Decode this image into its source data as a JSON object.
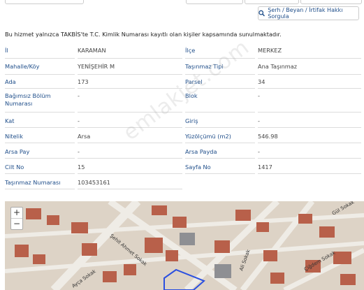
{
  "toolbar": {
    "query_label": "Şerh / Beyan / İrtifak Hakkı Sorgula"
  },
  "notice": "Bu hizmet yalnızca TAKBİS'te T.C. Kimlik Numarası kayıtlı olan kişiler kapsamında sunulmaktadır.",
  "parcel": {
    "rows": [
      {
        "l1": "İl",
        "v1": "KARAMAN",
        "l2": "İlçe",
        "v2": "MERKEZ"
      },
      {
        "l1": "Mahalle/Köy",
        "v1": "YENİŞEHİR M",
        "l2": "Taşınmaz Tipi",
        "v2": "Ana Taşınmaz"
      },
      {
        "l1": "Ada",
        "v1": "173",
        "l2": "Parsel",
        "v2": "34"
      },
      {
        "l1": "Bağımsız Bölüm Numarası",
        "v1": "-",
        "l2": "Blok",
        "v2": "-"
      },
      {
        "l1": "Kat",
        "v1": "-",
        "l2": "Giriş",
        "v2": "-"
      },
      {
        "l1": "Nitelik",
        "v1": "Arsa",
        "l2": "Yüzölçümü (m2)",
        "v2": "546.98"
      },
      {
        "l1": "Arsa Pay",
        "v1": "-",
        "l2": "Arsa Payda",
        "v2": "-"
      },
      {
        "l1": "Cilt No",
        "v1": "15",
        "l2": "Sayfa No",
        "v2": "1417"
      },
      {
        "l1": "Taşınmaz Numarası",
        "v1": "103453161",
        "l2": "",
        "v2": ""
      }
    ]
  },
  "map": {
    "zoom_in": "+",
    "zoom_out": "−",
    "street_labels": [
      "Ayça Sokak",
      "Ali Sokak",
      "Gül Sokak",
      "Çiğdem Sokak",
      "Şehit Ahmet Sokak"
    ]
  },
  "watermark": "emlakjet.com"
}
